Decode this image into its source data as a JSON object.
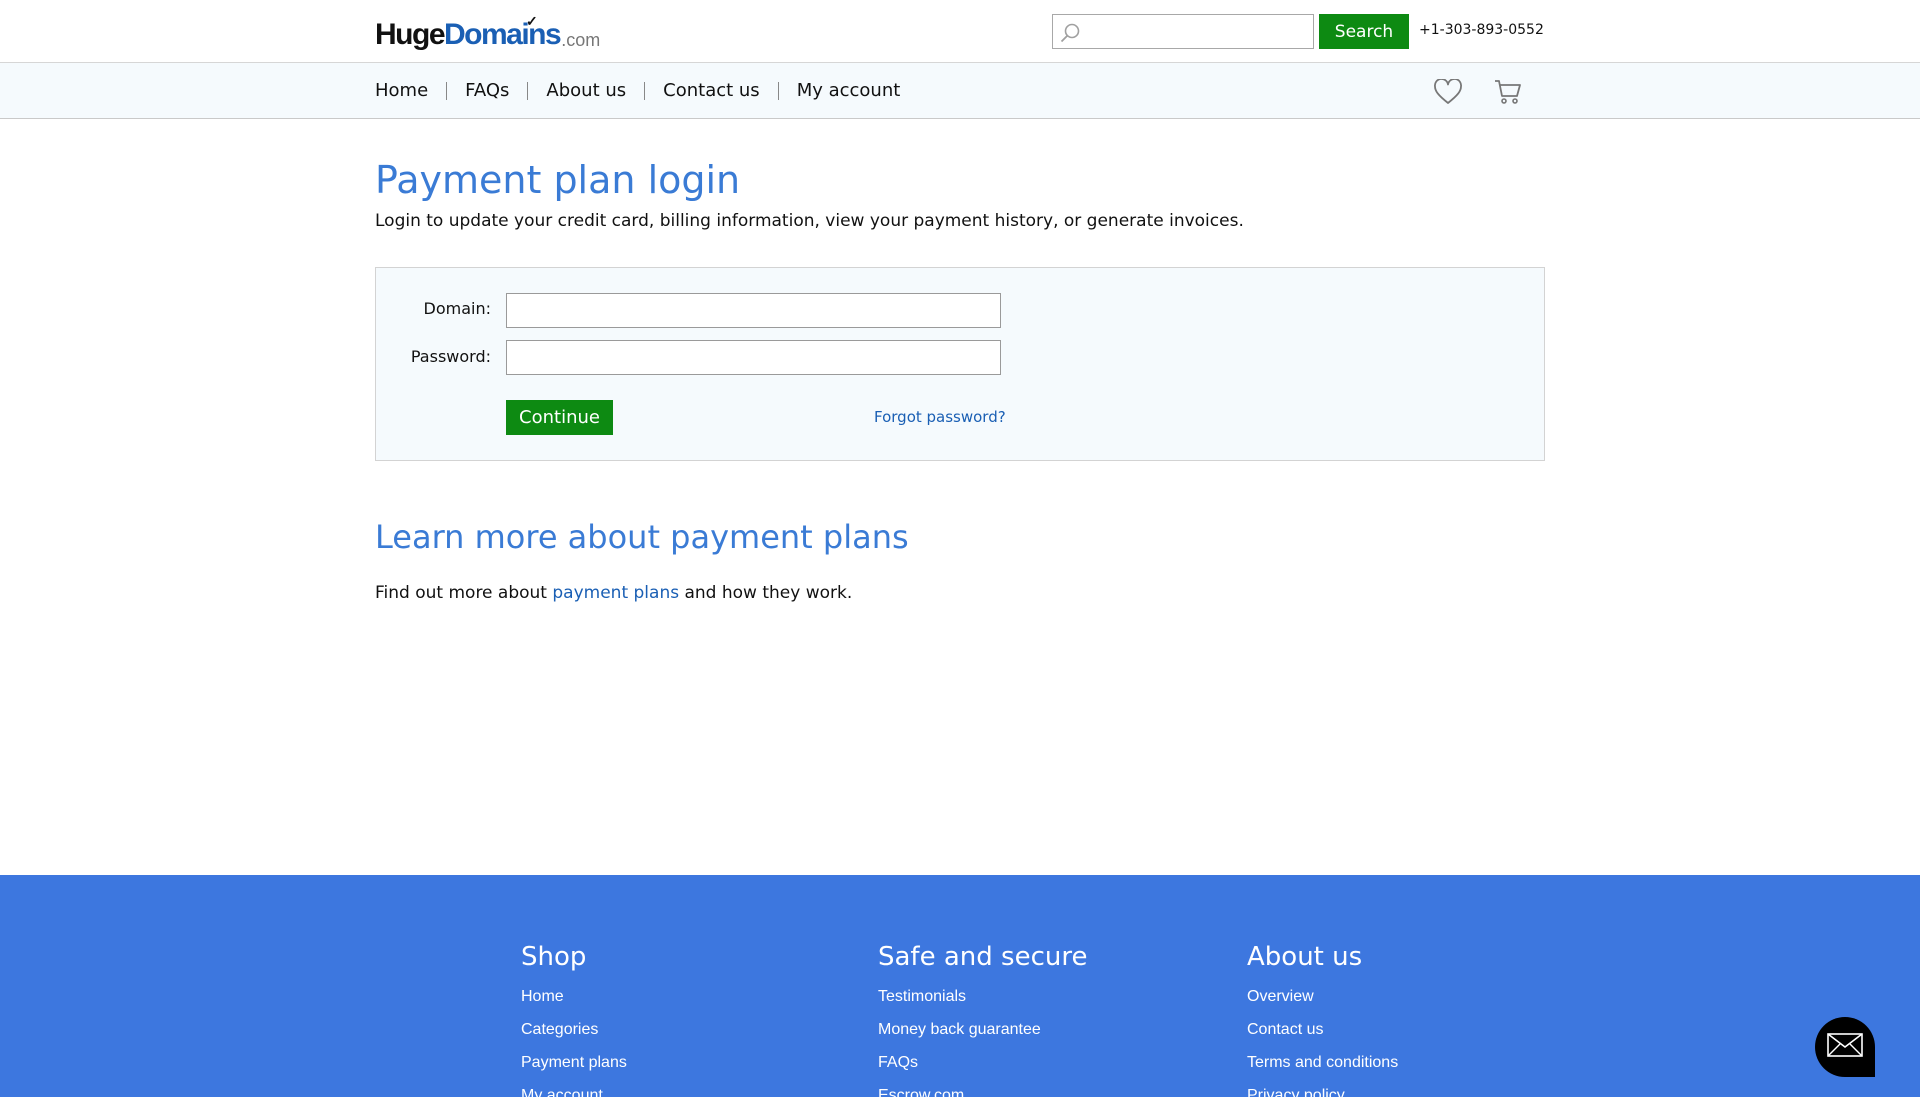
{
  "header": {
    "logo": {
      "huge": "Huge",
      "domains": "Domains",
      "com": ".com"
    },
    "search": {
      "placeholder": "",
      "value": "",
      "button_label": "Search"
    },
    "phone": "+1-303-893-0552"
  },
  "nav": {
    "items": [
      {
        "label": "Home"
      },
      {
        "label": "FAQs"
      },
      {
        "label": "About us"
      },
      {
        "label": "Contact us"
      },
      {
        "label": "My account"
      }
    ],
    "icons": [
      "heart-icon",
      "cart-icon"
    ]
  },
  "main": {
    "title": "Payment plan login",
    "subtitle": "Login to update your credit card, billing information, view your payment history, or generate invoices.",
    "form": {
      "domain_label": "Domain:",
      "domain_value": "",
      "password_label": "Password:",
      "password_value": "",
      "continue_label": "Continue",
      "forgot_label": "Forgot password?"
    },
    "learn": {
      "title": "Learn more about payment plans",
      "text_before": "Find out more about ",
      "link": "payment plans",
      "text_after": " and how they work."
    }
  },
  "footer": {
    "columns": [
      {
        "title": "Shop",
        "links": [
          "Home",
          "Categories",
          "Payment plans",
          "My account"
        ]
      },
      {
        "title": "Safe and secure",
        "links": [
          "Testimonials",
          "Money back guarantee",
          "FAQs",
          "Escrow.com"
        ]
      },
      {
        "title": "About us",
        "links": [
          "Overview",
          "Contact us",
          "Terms and conditions",
          "Privacy policy"
        ]
      }
    ]
  },
  "colors": {
    "accent_green": "#0d8a12",
    "title_blue": "#3a7bd5",
    "link_blue": "#1a5fb4",
    "footer_blue": "#3d77df",
    "panel_bg": "#f5fafd"
  },
  "chat_icon": "envelope-icon"
}
